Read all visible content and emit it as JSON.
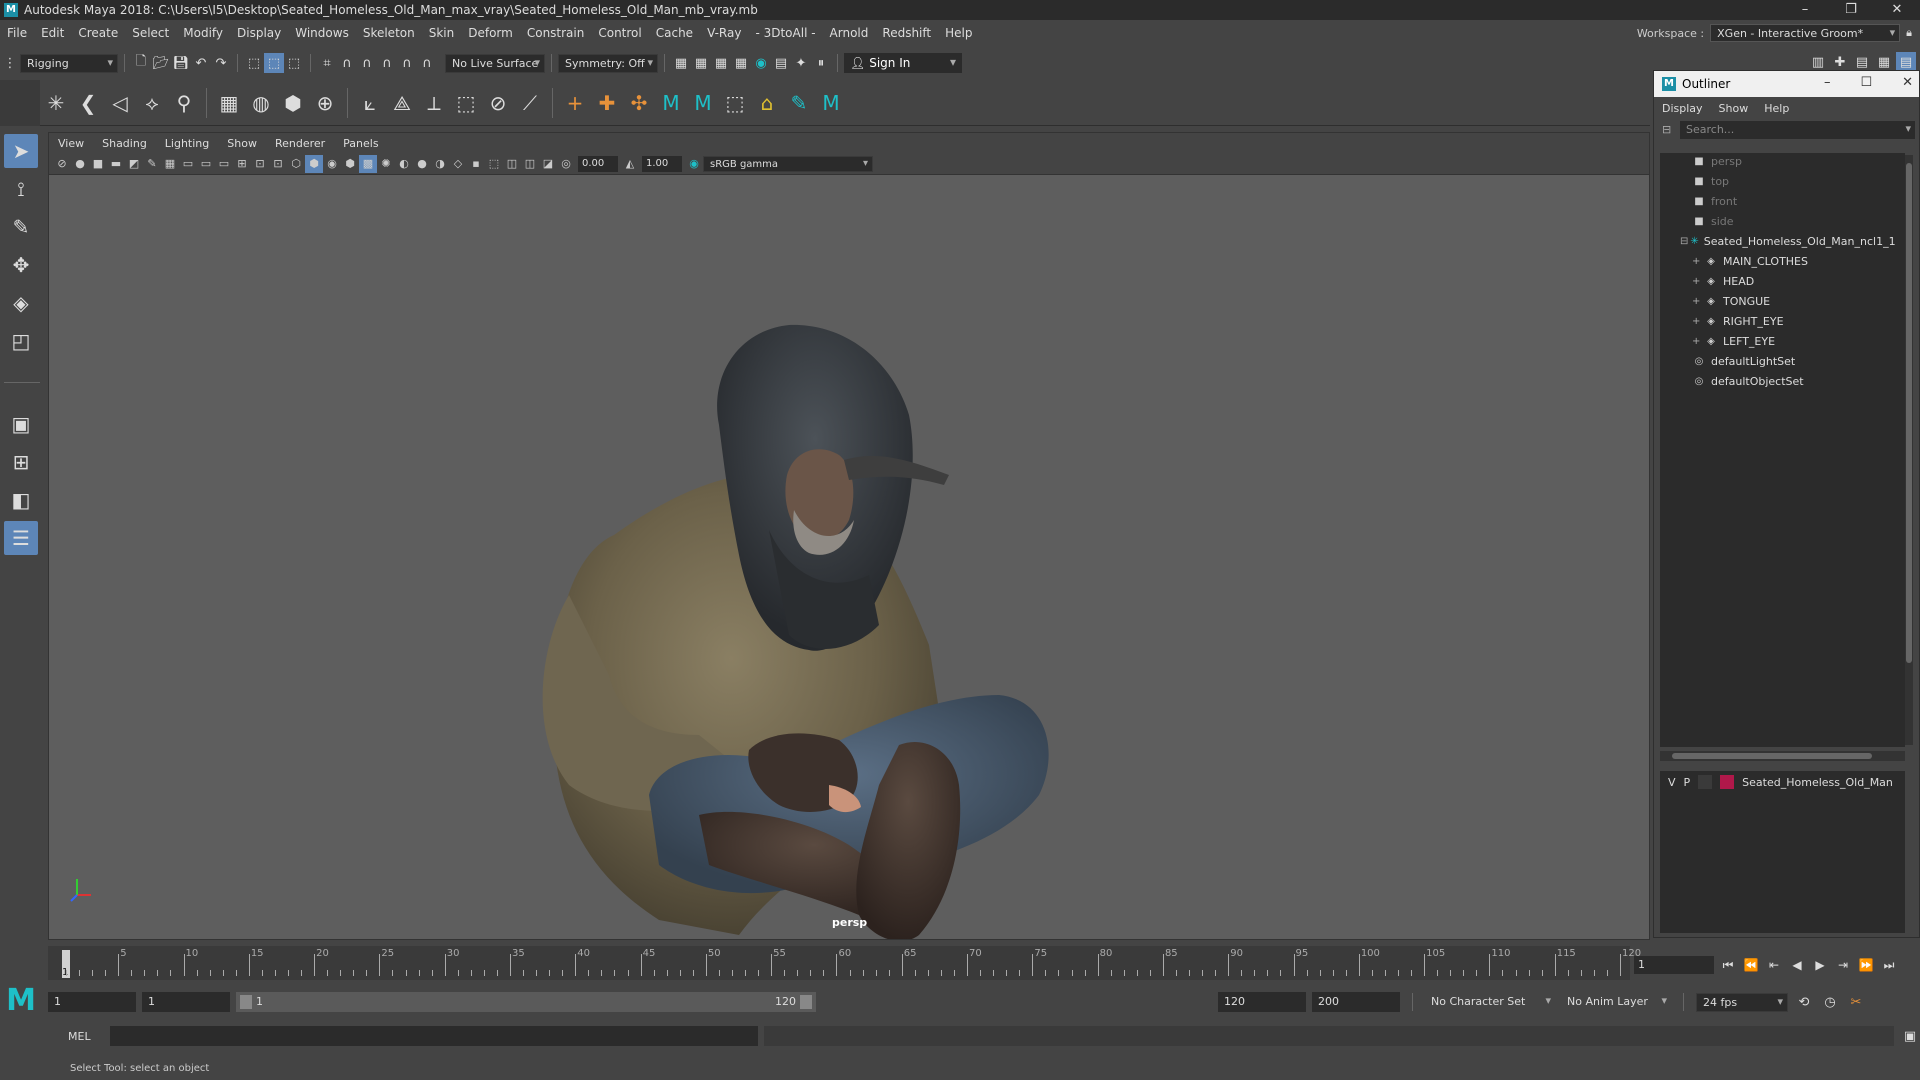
{
  "window": {
    "title": "Autodesk Maya 2018: C:\\Users\\I5\\Desktop\\Seated_Homeless_Old_Man_max_vray\\Seated_Homeless_Old_Man_mb_vray.mb"
  },
  "menubar": {
    "items": [
      "File",
      "Edit",
      "Create",
      "Select",
      "Modify",
      "Display",
      "Windows",
      "Skeleton",
      "Skin",
      "Deform",
      "Constrain",
      "Control",
      "Cache",
      "V-Ray",
      "- 3DtoAll -",
      "Arnold",
      "Redshift",
      "Help"
    ],
    "workspace_label": "Workspace :",
    "workspace_value": "XGen - Interactive Groom*"
  },
  "statusline": {
    "menuset": "Rigging",
    "live_surface": "No Live Surface",
    "symmetry": "Symmetry: Off",
    "signin": "Sign In"
  },
  "viewport": {
    "menus": [
      "View",
      "Shading",
      "Lighting",
      "Show",
      "Renderer",
      "Panels"
    ],
    "exposure": "0.00",
    "gamma": "1.00",
    "colorspace": "sRGB gamma",
    "camera": "persp"
  },
  "outliner": {
    "title": "Outliner",
    "menus": [
      "Display",
      "Show",
      "Help"
    ],
    "search_placeholder": "Search...",
    "cameras": [
      "persp",
      "top",
      "front",
      "side"
    ],
    "group": "Seated_Homeless_Old_Man_ncl1_1",
    "children": [
      "MAIN_CLOTHES",
      "HEAD",
      "TONGUE",
      "RIGHT_EYE",
      "LEFT_EYE"
    ],
    "sets": [
      "defaultLightSet",
      "defaultObjectSet"
    ],
    "layer": {
      "v": "V",
      "p": "P",
      "name": "Seated_Homeless_Old_Man"
    }
  },
  "timeslider": {
    "ticks": [
      "5",
      "10",
      "15",
      "20",
      "25",
      "30",
      "35",
      "40",
      "45",
      "50",
      "55",
      "60",
      "65",
      "70",
      "75",
      "80",
      "85",
      "90",
      "95",
      "100",
      "105",
      "110",
      "115",
      "120"
    ],
    "current": "1",
    "current_field": "1"
  },
  "rangeslider": {
    "start": "1",
    "playback_start": "1",
    "range_start_label": "1",
    "range_end_label": "120",
    "playback_end": "120",
    "end": "200",
    "character_set": "No Character Set",
    "anim_layer": "No Anim Layer",
    "fps": "24 fps"
  },
  "cmdline": {
    "label": "MEL",
    "help": "Select Tool: select an object"
  }
}
